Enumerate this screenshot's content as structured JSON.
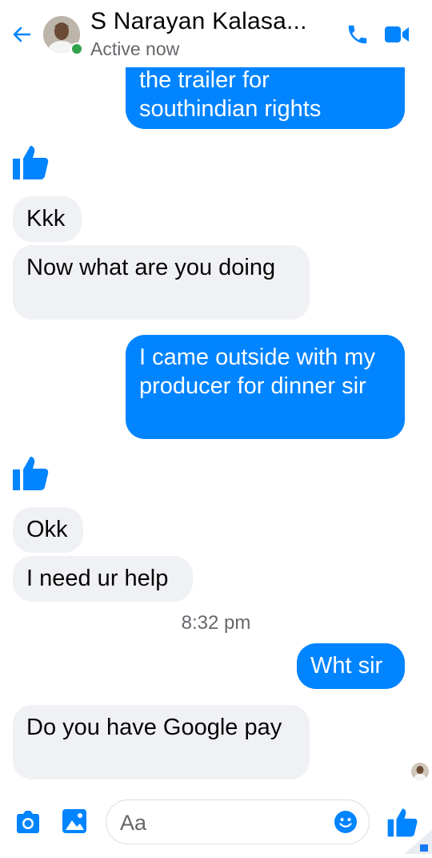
{
  "header": {
    "contact_name": "S Narayan Kalasa...",
    "status": "Active now"
  },
  "messages": {
    "m0": "the trailer for southindian rights",
    "m1": "Kkk",
    "m2": "Now what are you doing",
    "m3": "I came outside with my producer for dinner sir",
    "m4": "Okk",
    "m5": "I need ur help",
    "timestamp": "8:32 pm",
    "m6": "Wht sir",
    "m7": "Do you have Google pay"
  },
  "composer": {
    "placeholder": "Aa"
  },
  "colors": {
    "accent": "#0084ff",
    "incoming_bubble": "#f0f1f4",
    "presence": "#31a24c"
  },
  "icons": [
    "back-arrow-icon",
    "phone-icon",
    "video-camera-icon",
    "thumbs-up-icon",
    "camera-icon",
    "gallery-icon",
    "emoji-icon"
  ]
}
